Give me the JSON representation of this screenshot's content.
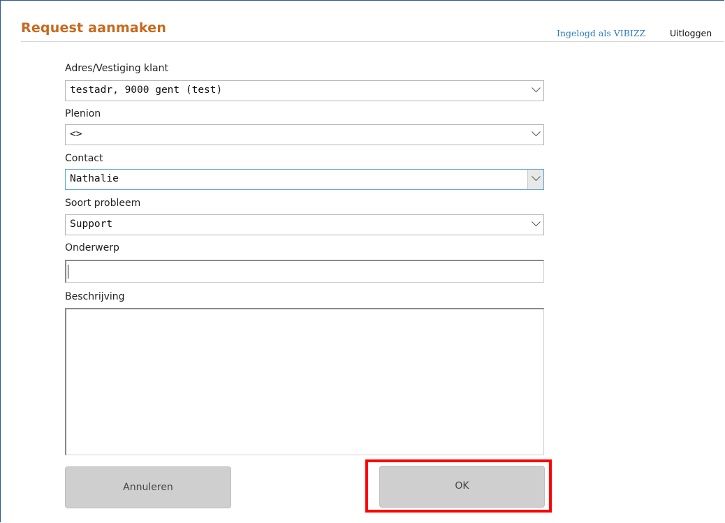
{
  "header": {
    "title": "Request aanmaken",
    "login_status": "Ingelogd als VIBIZZ",
    "logout_label": "Uitloggen"
  },
  "form": {
    "address": {
      "label": "Adres/Vestiging klant",
      "value": "testadr, 9000 gent (test)"
    },
    "plenion": {
      "label": "Plenion",
      "value": "<>"
    },
    "contact": {
      "label": "Contact",
      "value": "Nathalie"
    },
    "problem_type": {
      "label": "Soort probleem",
      "value": "Support"
    },
    "subject": {
      "label": "Onderwerp",
      "value": ""
    },
    "description": {
      "label": "Beschrijving",
      "value": ""
    }
  },
  "buttons": {
    "cancel_label": "Annuleren",
    "ok_label": "OK"
  },
  "colors": {
    "title": "#c8691c",
    "login_link": "#2e7dbd",
    "highlight": "#ff0000",
    "button_bg": "#cfcfcf",
    "focus_border": "#62a8d9"
  },
  "icons": {
    "dropdown": "chevron-down-icon"
  }
}
